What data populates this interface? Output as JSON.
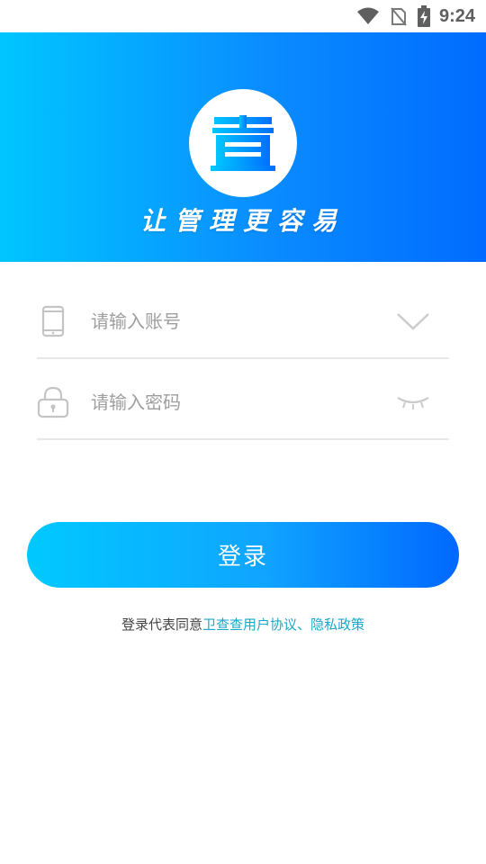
{
  "status_bar": {
    "time": "9:24",
    "icons": [
      "wifi-icon",
      "no-sim-icon",
      "battery-charging-icon"
    ]
  },
  "header": {
    "logo_icon": "cha-logo-icon",
    "logo_char": "查",
    "slogan": "让管理更容易",
    "gradient_start": "#00c6ff",
    "gradient_end": "#006cff"
  },
  "form": {
    "account": {
      "placeholder": "请输入账号",
      "value": "",
      "icon": "phone-icon",
      "action_icon": "chevron-down-icon"
    },
    "password": {
      "placeholder": "请输入密码",
      "value": "",
      "icon": "lock-icon",
      "action_icon": "eye-closed-icon"
    }
  },
  "login_button": {
    "label": "登录"
  },
  "agreement": {
    "prefix": "登录代表同意",
    "link_text": "卫查查用户协议、隐私政策",
    "link_color": "#1aa7c9"
  }
}
